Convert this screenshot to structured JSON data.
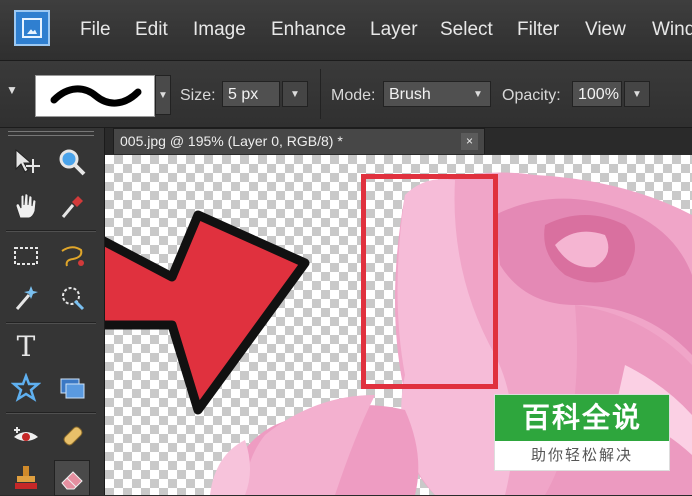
{
  "menu": {
    "items": [
      "File",
      "Edit",
      "Image",
      "Enhance",
      "Layer",
      "Select",
      "Filter",
      "View",
      "Windo"
    ]
  },
  "options": {
    "size_label": "Size:",
    "size_value": "5 px",
    "mode_label": "Mode:",
    "mode_value": "Brush",
    "opacity_label": "Opacity:",
    "opacity_value": "100%"
  },
  "document": {
    "tab_title": "005.jpg @ 195% (Layer 0, RGB/8) *",
    "close_glyph": "×"
  },
  "tools": {
    "icons": [
      "move-icon",
      "zoom-icon",
      "hand-icon",
      "eyedropper-icon",
      "marquee-icon",
      "lasso-icon",
      "magic-wand-icon",
      "quick-selection-icon",
      "type-icon",
      "custom-shape-icon",
      "layer-style-icon",
      "red-eye-icon",
      "healing-brush-icon",
      "stamp-icon",
      "eraser-icon"
    ],
    "type_glyph": "T",
    "selected": "eraser-icon"
  },
  "annotation": {
    "arrow_color": "#e0313e",
    "box_color": "#e0313e"
  },
  "watermark": {
    "title": "百科全说",
    "subtitle": "助你轻松解决",
    "color": "#2ea63d"
  }
}
